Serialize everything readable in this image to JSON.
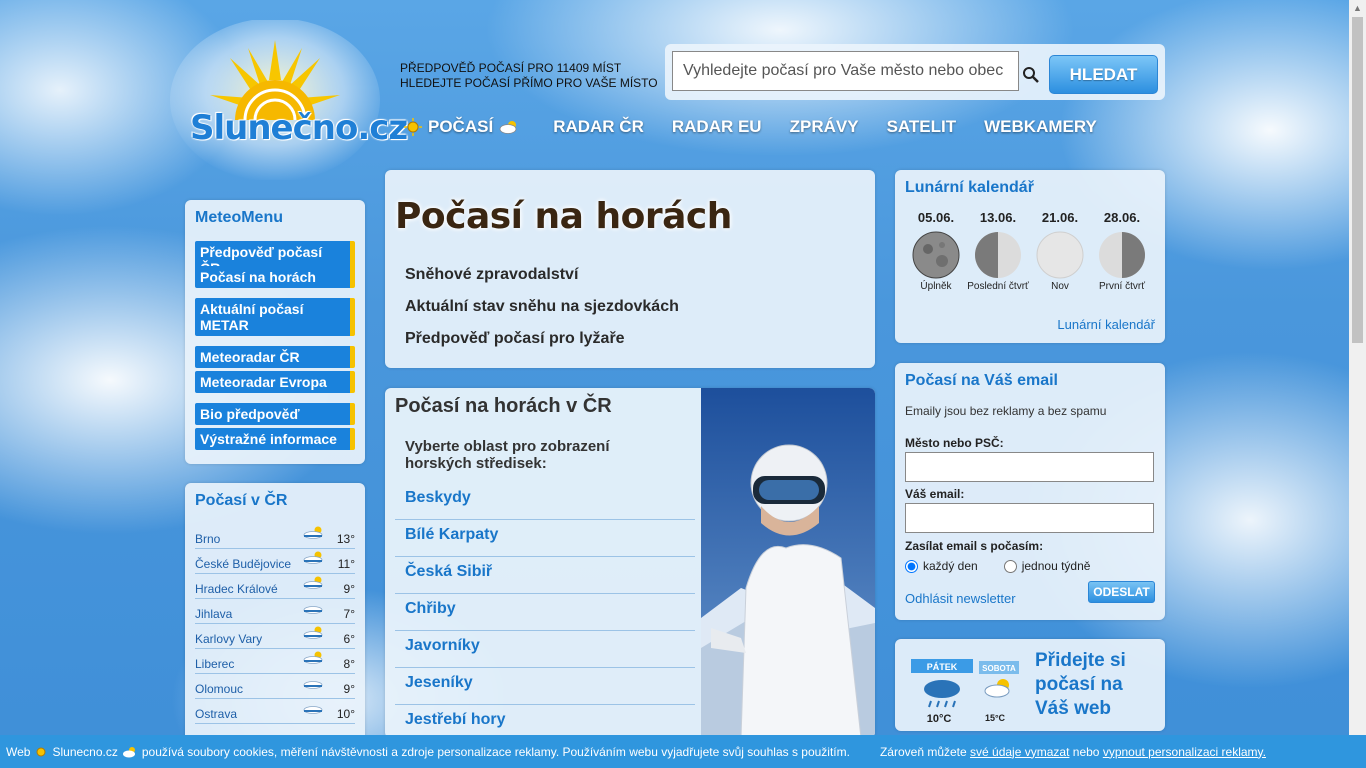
{
  "brand": {
    "logo_text": "Slunečno.cz"
  },
  "header": {
    "tagline_line1": "Předpověď počasí pro 11409 míst",
    "tagline_line2": "Hledejte počasí přímo pro vaše místo",
    "search_placeholder": "Vyhledejte počasí pro Vaše město nebo obec",
    "search_button": "HLEDAT"
  },
  "nav": [
    {
      "label": "POČASÍ",
      "icon_before": "sun-icon",
      "icon_after": "cloud-icon"
    },
    {
      "label": "RADAR ČR"
    },
    {
      "label": "RADAR EU"
    },
    {
      "label": "ZPRÁVY"
    },
    {
      "label": "SATELIT"
    },
    {
      "label": "WEBKAMERY"
    }
  ],
  "meteomenu": {
    "title": "MeteoMenu",
    "items": [
      "Předpověď počasí ČR",
      "Počasí na horách",
      "Aktuální počasí METAR",
      "Meteoradar ČR",
      "Meteoradar Evropa",
      "Bio předpověď",
      "Výstražné informace"
    ]
  },
  "pocasi_cr": {
    "title": "Počasí v ČR",
    "cities": [
      {
        "name": "Brno",
        "temp": "13°",
        "icon": "sun-cloud-icon"
      },
      {
        "name": "České Budějovice",
        "temp": "11°",
        "icon": "sun-cloud-icon"
      },
      {
        "name": "Hradec Králové",
        "temp": "9°",
        "icon": "sun-cloud-icon"
      },
      {
        "name": "Jihlava",
        "temp": "7°",
        "icon": "cloud-icon"
      },
      {
        "name": "Karlovy Vary",
        "temp": "6°",
        "icon": "sun-cloud-icon"
      },
      {
        "name": "Liberec",
        "temp": "8°",
        "icon": "sun-cloud-icon"
      },
      {
        "name": "Olomouc",
        "temp": "9°",
        "icon": "cloud-icon"
      },
      {
        "name": "Ostrava",
        "temp": "10°",
        "icon": "cloud-icon"
      }
    ]
  },
  "main": {
    "title": "Počasí na horách",
    "links": [
      "Sněhové zpravodalství",
      "Aktuální stav sněhu na sjezdovkách",
      "Předpověď počasí pro lyžaře"
    ]
  },
  "mountains": {
    "title": "Počasí na horách v ČR",
    "intro": "Vyberte oblast pro zobrazení horských středisek:",
    "regions": [
      "Beskydy",
      "Bílé Karpaty",
      "Česká Sibiř",
      "Chřiby",
      "Javorníky",
      "Jeseníky",
      "Jestřebí hory"
    ]
  },
  "lunar": {
    "title": "Lunární kalendář",
    "phases": [
      {
        "date": "05.06.",
        "name": "Úplněk"
      },
      {
        "date": "13.06.",
        "name": "Poslední čtvrť"
      },
      {
        "date": "21.06.",
        "name": "Nov"
      },
      {
        "date": "28.06.",
        "name": "První čtvrť"
      }
    ],
    "link": "Lunární kalendář"
  },
  "email": {
    "title": "Počasí na Váš email",
    "note": "Emaily jsou bez reklamy a bez spamu",
    "city_label": "Město nebo PSČ:",
    "email_label": "Váš email:",
    "frequency_label": "Zasílat email s počasím:",
    "option_daily": "každý den",
    "option_weekly": "jednou týdně",
    "unsubscribe": "Odhlásit newsletter",
    "send_button": "ODESLAT"
  },
  "widget": {
    "text": "Přidejte si počasí na Váš web",
    "day1": "PÁTEK",
    "day2": "SOBOTA",
    "temp1": "10°C",
    "temp2": "15°C"
  },
  "cookie": {
    "prefix": "Web",
    "site": "Slunecno.cz",
    "text": "používá soubory cookies, měření návštěvnosti a zdroje personalizace reklamy. Používáním webu vyjadřujete svůj souhlas s použitím.",
    "text2": "Zároveň můžete",
    "link1": "své údaje vymazat",
    "text3": "nebo",
    "link2": "vypnout personalizaci reklamy."
  },
  "colors": {
    "accent": "#1976c9",
    "menu_bg": "#1a82dc",
    "menu_stripe": "#f6c200",
    "cookie_bg": "#2f96de"
  }
}
